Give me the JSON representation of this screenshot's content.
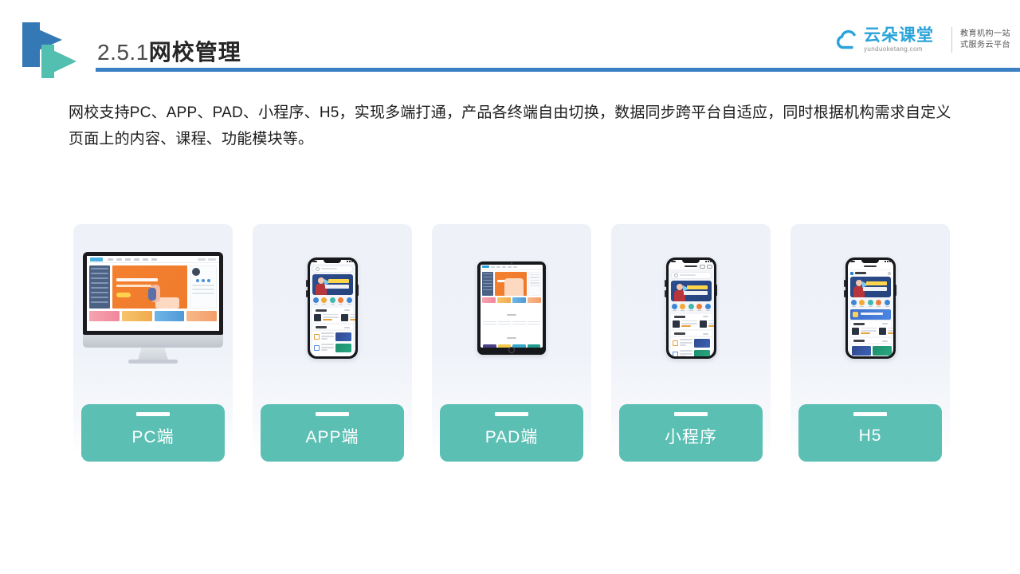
{
  "header": {
    "title_number": "2.5.1",
    "title_text": "网校管理",
    "rule_color": "#3b7fc4",
    "logo_icon": "double-triangle-logo",
    "logo_colors": [
      "#3479b5",
      "#52bfb0"
    ]
  },
  "brand": {
    "icon": "cloud-icon",
    "name": "云朵课堂",
    "domain": "yunduoketang.com",
    "tagline_line1": "教育机构一站",
    "tagline_line2": "式服务云平台",
    "name_color": "#2aa3da"
  },
  "body": {
    "paragraph": "网校支持PC、APP、PAD、小程序、H5，实现多端打通，产品各终端自由切换，数据同步跨平台自适应，同时根据机构需求自定义页面上的内容、课程、功能模块等。"
  },
  "cards": [
    {
      "label": "PC端",
      "device": "desktop-monitor",
      "icon": "desktop-icon"
    },
    {
      "label": "APP端",
      "device": "smartphone",
      "icon": "mobile-icon"
    },
    {
      "label": "PAD端",
      "device": "tablet",
      "icon": "tablet-icon"
    },
    {
      "label": "小程序",
      "device": "smartphone",
      "icon": "miniprogram-icon"
    },
    {
      "label": "H5",
      "device": "smartphone",
      "icon": "h5-icon"
    }
  ],
  "theme": {
    "label_box_color": "#5cbfb4",
    "card_background_top": "#eef1f7",
    "card_background_bottom": "#ffffff",
    "page_background": "#ffffff"
  }
}
